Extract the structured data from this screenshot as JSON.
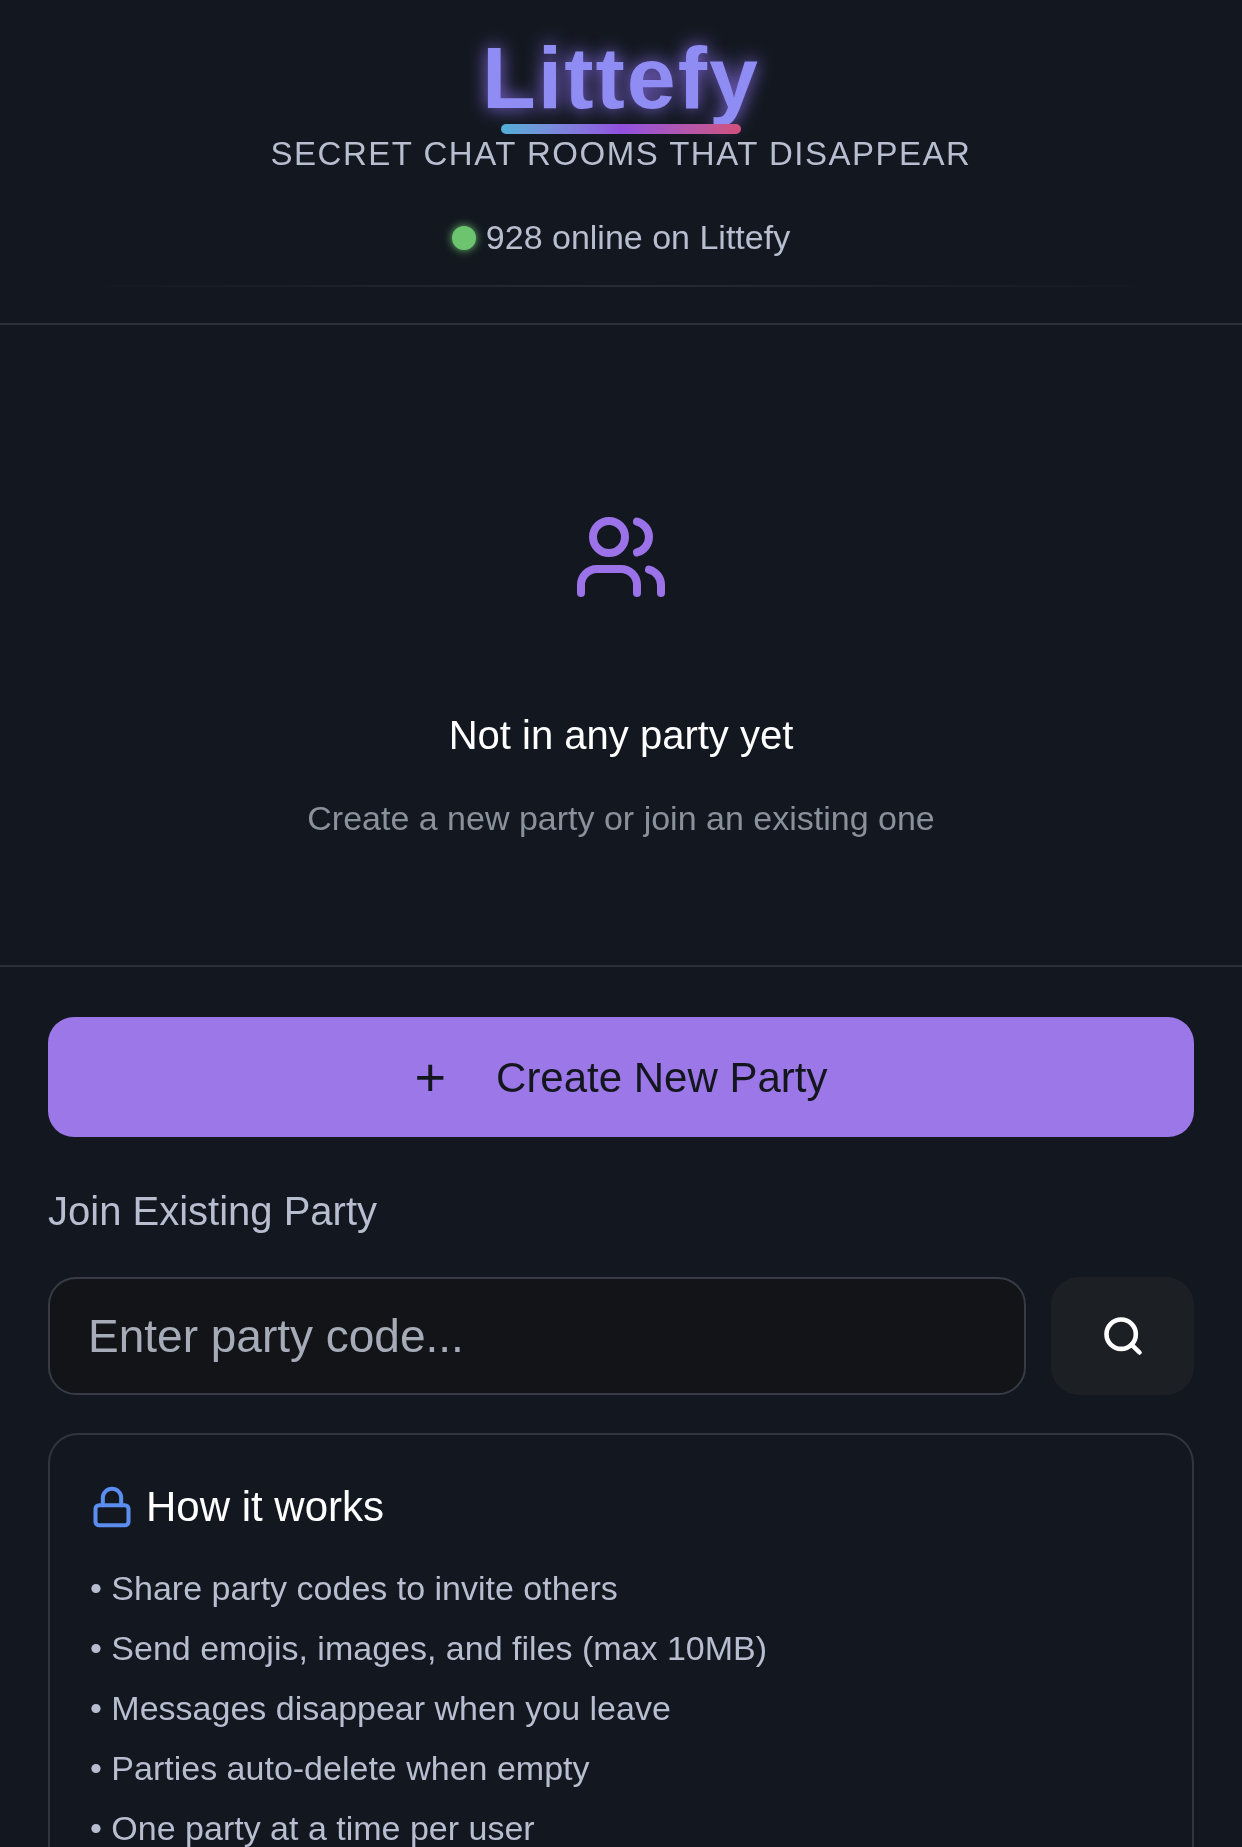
{
  "header": {
    "logo": "Littefy",
    "tagline": "SECRET CHAT ROOMS THAT DISAPPEAR",
    "online": {
      "text": "928 online on Littefy",
      "color": "#6cc46f"
    }
  },
  "empty_state": {
    "title": "Not in any party yet",
    "subtitle": "Create a new party or join an existing one"
  },
  "create_button": {
    "icon": "+",
    "label": "Create New Party"
  },
  "join": {
    "label": "Join Existing Party",
    "placeholder": "Enter party code..."
  },
  "info_card": {
    "title": "How it works",
    "items": [
      "• Share party codes to invite others",
      "• Send emojis, images, and files (max 10MB)",
      "• Messages disappear when you leave",
      "• Parties auto-delete when empty",
      "• One party at a time per user"
    ]
  }
}
